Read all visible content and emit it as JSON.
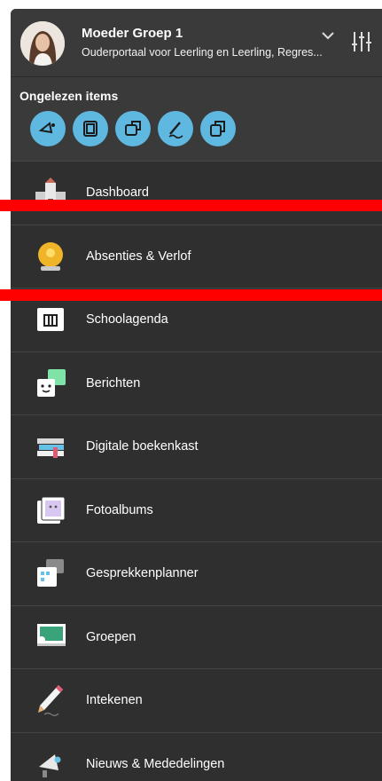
{
  "header": {
    "title": "Moeder Groep 1",
    "subtitle": "Ouderportaal voor Leerling en Leerling, Regres..."
  },
  "unread": {
    "title": "Ongelezen items",
    "badges": [
      {
        "icon": "megaphone-icon"
      },
      {
        "icon": "photo-album-icon"
      },
      {
        "icon": "chat-icon"
      },
      {
        "icon": "pen-sign-icon"
      },
      {
        "icon": "documents-icon"
      }
    ]
  },
  "menu": {
    "items": [
      {
        "label": "Dashboard",
        "icon": "school-building-icon"
      },
      {
        "label": "Absenties & Verlof",
        "icon": "bell-icon"
      },
      {
        "label": "Schoolagenda",
        "icon": "calendar-icon"
      },
      {
        "label": "Berichten",
        "icon": "chat-bubbles-icon"
      },
      {
        "label": "Digitale boekenkast",
        "icon": "books-icon"
      },
      {
        "label": "Fotoalbums",
        "icon": "photo-albums-icon"
      },
      {
        "label": "Gesprekkenplanner",
        "icon": "planner-icon"
      },
      {
        "label": "Groepen",
        "icon": "blackboard-icon"
      },
      {
        "label": "Intekenen",
        "icon": "pencil-icon"
      },
      {
        "label": "Nieuws & Mededelingen",
        "icon": "megaphone-icon"
      }
    ]
  },
  "colors": {
    "panel": "#2f2f2f",
    "header": "#3a3a3a",
    "badge": "#5fb8df",
    "overlay_bar": "#ff0000"
  }
}
